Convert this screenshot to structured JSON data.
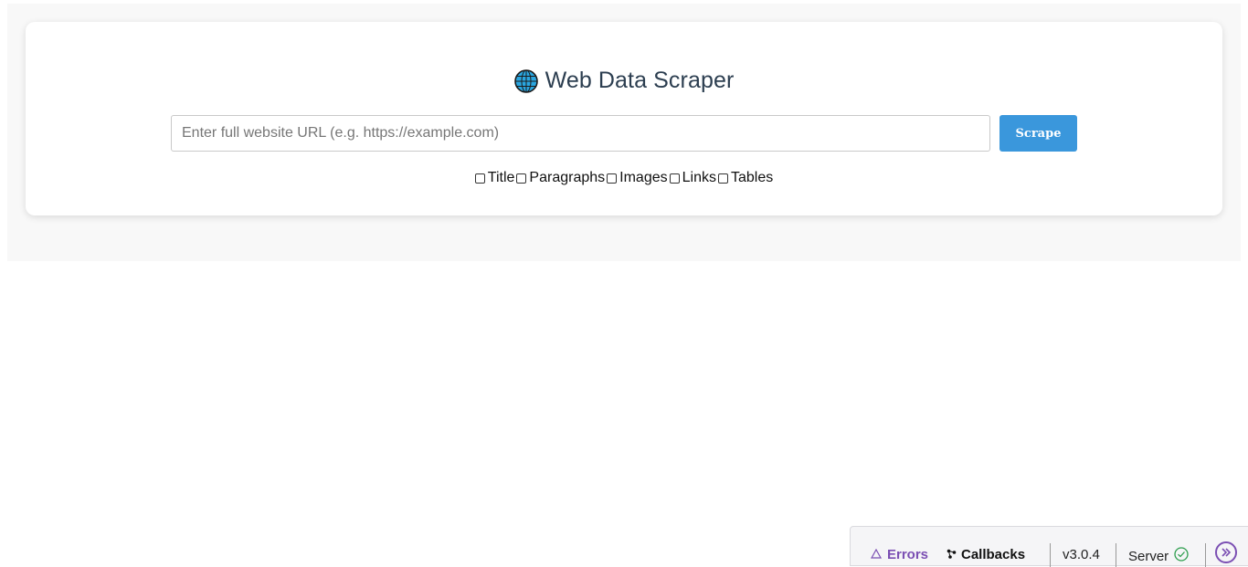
{
  "app": {
    "title": "Web Data Scraper",
    "globe_icon": "globe-icon"
  },
  "search": {
    "placeholder": "Enter full website URL (e.g. https://example.com)",
    "value": "",
    "button_label": "Scrape",
    "button_color": "#3a97dc"
  },
  "options": [
    {
      "label": "Title",
      "checked": false
    },
    {
      "label": "Paragraphs",
      "checked": false
    },
    {
      "label": "Images",
      "checked": false
    },
    {
      "label": "Links",
      "checked": false
    },
    {
      "label": "Tables",
      "checked": false
    }
  ],
  "devtools": {
    "errors_label": "Errors",
    "callbacks_label": "Callbacks",
    "version": "v3.0.4",
    "server_label": "Server",
    "server_status": "ok",
    "accent": "#7b4fb3"
  }
}
